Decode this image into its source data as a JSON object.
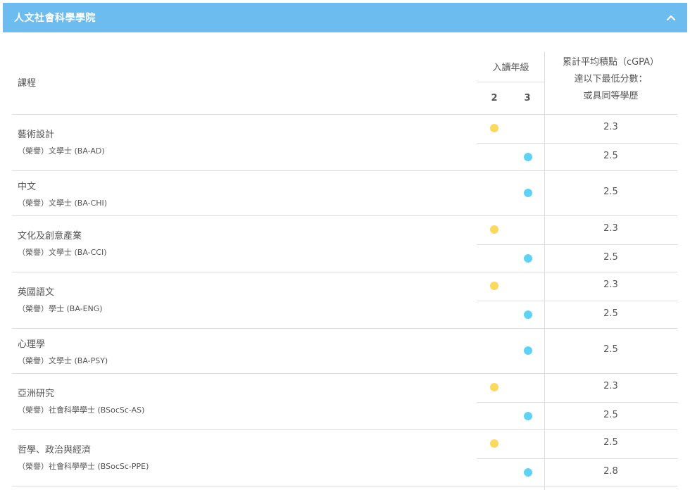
{
  "panel": {
    "title": "人文社會科學學院",
    "expanded": true,
    "toggle_icon": "chevron-up-icon"
  },
  "table": {
    "headers": {
      "course": "課程",
      "entry_year": "入讀年級",
      "year_2": "2",
      "year_3": "3",
      "cgpa_line1": "累計平均積點（cGPA）",
      "cgpa_line2": "達以下最低分數：",
      "cgpa_line3": "或具同等學歷"
    },
    "legend_colors": {
      "year_2": "#fbd95b",
      "year_3": "#5fd3f7"
    },
    "programmes": [
      {
        "name": "藝術設計",
        "degree": "（榮譽）文學士 (BA-AD)",
        "rows": [
          {
            "year": 2,
            "cgpa": "2.3"
          },
          {
            "year": 3,
            "cgpa": "2.5"
          }
        ]
      },
      {
        "name": "中文",
        "degree": "（榮譽）文學士 (BA-CHI)",
        "rows": [
          {
            "year": 3,
            "cgpa": "2.5"
          }
        ]
      },
      {
        "name": "文化及創意產業",
        "degree": "（榮譽）文學士 (BA-CCI)",
        "rows": [
          {
            "year": 2,
            "cgpa": "2.3"
          },
          {
            "year": 3,
            "cgpa": "2.5"
          }
        ]
      },
      {
        "name": "英國語文",
        "degree": "（榮譽）學士 (BA-ENG)",
        "rows": [
          {
            "year": 2,
            "cgpa": "2.3"
          },
          {
            "year": 3,
            "cgpa": "2.5"
          }
        ]
      },
      {
        "name": "心理學",
        "degree": "（榮譽）文學士 (BA-PSY)",
        "rows": [
          {
            "year": 3,
            "cgpa": "2.5"
          }
        ]
      },
      {
        "name": "亞洲研究",
        "degree": "（榮譽）社會科學學士 (BSocSc-AS)",
        "rows": [
          {
            "year": 2,
            "cgpa": "2.3"
          },
          {
            "year": 3,
            "cgpa": "2.5"
          }
        ]
      },
      {
        "name": "哲學、政治與經濟",
        "degree": "（榮譽）社會科學學士 (BSocSc-PPE)",
        "rows": [
          {
            "year": 2,
            "cgpa": "2.5"
          },
          {
            "year": 3,
            "cgpa": "2.8"
          }
        ]
      }
    ]
  }
}
